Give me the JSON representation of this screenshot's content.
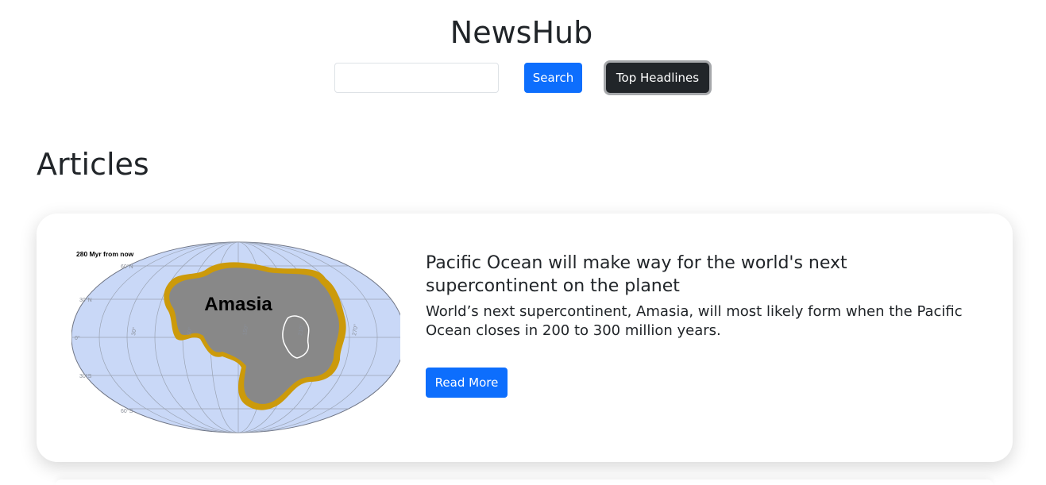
{
  "header": {
    "site_title": "NewsHub",
    "search_placeholder": "",
    "search_value": "",
    "search_button_label": "Search",
    "top_headlines_button_label": "Top Headlines"
  },
  "main": {
    "section_heading": "Articles",
    "articles": [
      {
        "title": "Pacific Ocean will make way for the world's next supercontinent on the planet",
        "description": "World’s next supercontinent, Amasia, will most likely form when the Pacific Ocean closes in 200 to 300 million years.",
        "read_more_label": "Read More",
        "image": {
          "caption": "280 Myr from now",
          "map_label": "Amasia",
          "lat_labels": [
            "60°N",
            "30°N",
            "0°",
            "30°S",
            "60°S"
          ],
          "lon_labels": [
            "30°",
            "90°",
            "150°",
            "210°",
            "270°"
          ],
          "colors": {
            "ocean": "#c9d8f7",
            "land": "#888888",
            "shelf": "#cc9a0a",
            "grid": "#9aa3b3"
          }
        }
      }
    ]
  }
}
